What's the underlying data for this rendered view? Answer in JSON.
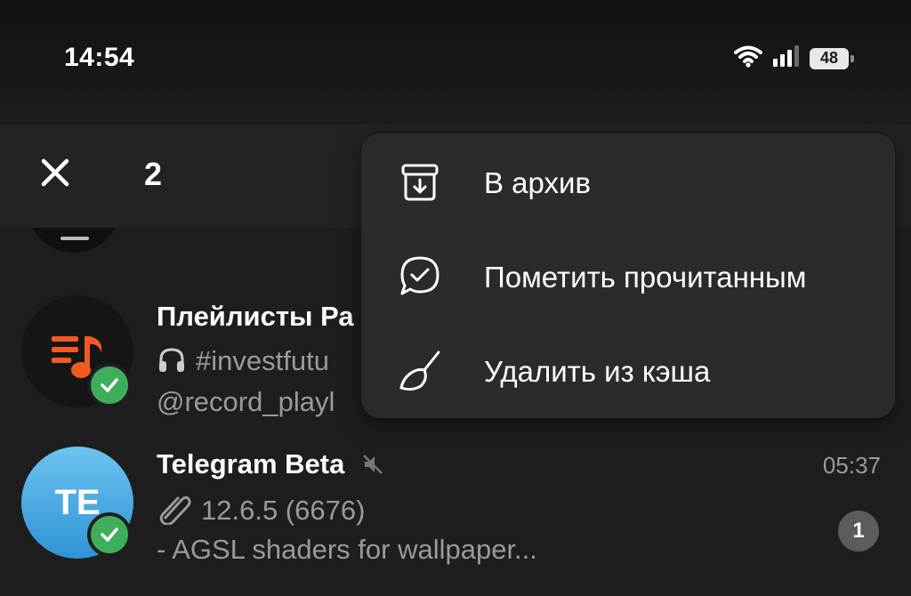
{
  "status_bar": {
    "time": "14:54",
    "battery": "48"
  },
  "selection": {
    "count": "2"
  },
  "menu": {
    "items": [
      {
        "label": "В архив",
        "icon": "archive-icon"
      },
      {
        "label": "Пометить прочитанным",
        "icon": "read-chat-icon"
      },
      {
        "label": "Удалить из кэша",
        "icon": "broom-icon"
      }
    ]
  },
  "chats": [
    {
      "name": "Плейлисты Ра",
      "line1": "#investfutu",
      "line2": "@record_playl",
      "avatar_icon": "music-playlist-icon",
      "avatar_color": "#151515",
      "accent": "#f05a22",
      "selected": true
    },
    {
      "name": "Telegram Beta",
      "line1": "12.6.5 (6676)",
      "line2": "- AGSL shaders for wallpaper...",
      "time": "05:37",
      "unread": "1",
      "avatar_initials": "TE",
      "avatar_color": "#3aa0dd",
      "muted": true,
      "selected": true
    }
  ],
  "colors": {
    "check": "#3fae5c",
    "menu_bg": "#2b2b2b",
    "background": "#1e1e1e"
  }
}
